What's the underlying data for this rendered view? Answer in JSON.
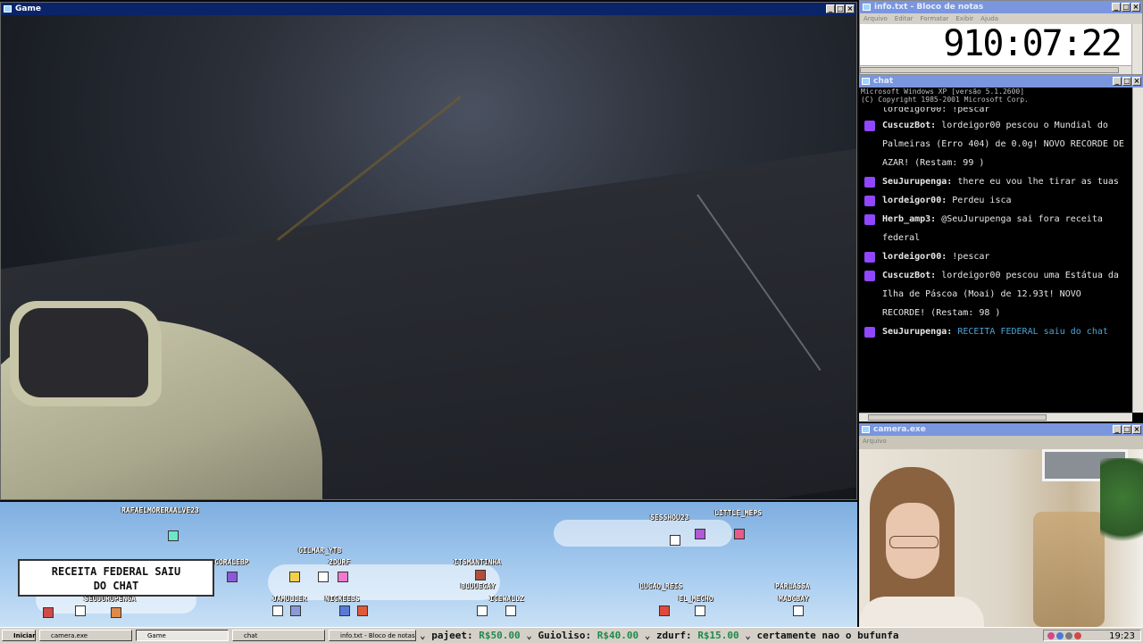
{
  "game_window": {
    "title": "Game"
  },
  "overlay": {
    "viewers": [
      "RAFAELMORERAALVE23",
      "SESSHOU23",
      "LITTLE_MEPS",
      "GILMAR_YTB",
      "ZDURF",
      "CORALEBP",
      "ITSMANTINHA",
      "BLUUECAY",
      "LUCAO_REIS",
      "PARLASSA",
      "MADGBAY",
      "EL_MECHO",
      "JAMULLER",
      "NICKEEBS",
      "ICEWALLZ",
      "SEUJURUPENGA"
    ],
    "notice_line1": "RECEITA FEDERAL SAIU",
    "notice_line2": "DO CHAT"
  },
  "clock_window": {
    "title": "info.txt - Bloco de notas",
    "menu": [
      "Arquivo",
      "Editar",
      "Formatar",
      "Exibir",
      "Ajuda"
    ],
    "time": "910:07:22"
  },
  "chat_window": {
    "title": "chat",
    "console_line1": "Microsoft Windows XP [versão 5.1.2600]",
    "console_line2": "(C) Copyright 1985-2001 Microsoft Corp.",
    "partial_line": "lordeigor00: !pescar",
    "messages": [
      {
        "user": "CuscuzBot:",
        "text": "lordeigor00 pescou o Mundial do Palmeiras (Erro 404) de 0.0g! NOVO RECORDE DE AZAR! (Restam: 99 )"
      },
      {
        "user": "SeuJurupenga:",
        "text": "there eu vou lhe tirar as tuas"
      },
      {
        "user": "lordeigor00:",
        "text": "Perdeu isca"
      },
      {
        "user": "Herb_amp3:",
        "text": "@SeuJurupenga sai fora receita federal"
      },
      {
        "user": "lordeigor00:",
        "text": "!pescar"
      },
      {
        "user": "CuscuzBot:",
        "text": "lordeigor00 pescou uma Estátua da Ilha de Páscoa (Moai) de 12.93t! NOVO RECORDE! (Restam: 98 )"
      },
      {
        "user": "SeuJurupenga:",
        "text": "RECEITA FEDERAL saiu do chat"
      }
    ]
  },
  "camera_window": {
    "title": "camera.exe",
    "menu_label": "Arquivo"
  },
  "taskbar": {
    "start": "Iniciar",
    "tasks": [
      "camera.exe",
      "Game",
      "chat",
      "info.txt - Bloco de notas"
    ],
    "ticker": [
      {
        "name": "pajeet:",
        "amount": "R$50.00"
      },
      {
        "name": "Guioliso:",
        "amount": "R$40.00"
      },
      {
        "name": "zdurf:",
        "amount": "R$15.00"
      },
      {
        "name": "certamente nao o bufunfa",
        "amount": ""
      }
    ],
    "clock": "19:23"
  },
  "colors": {
    "titlebar_active": "#0a246a",
    "titlebar_inactive": "#7a96df",
    "twitch_badge": "#9146ff",
    "donation_green": "#1e8a4a"
  }
}
